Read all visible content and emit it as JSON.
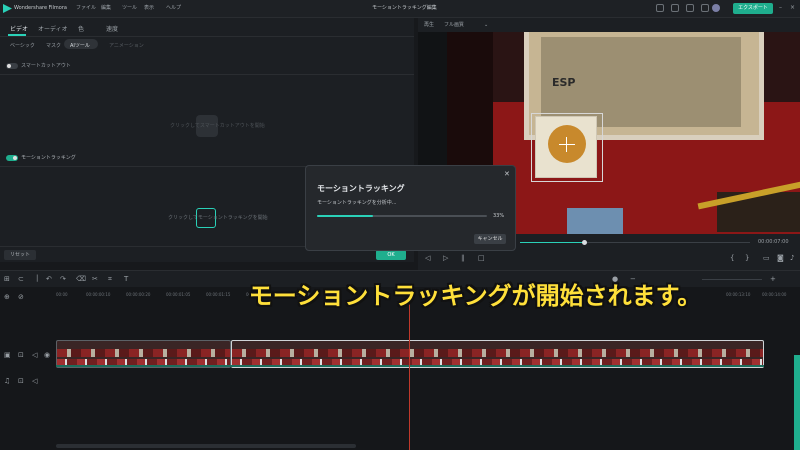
{
  "app": {
    "name": "Wondershare Filmora",
    "window_title": "モーショントラッキング編集",
    "menu": [
      "ファイル",
      "編集",
      "ツール",
      "表示",
      "ヘルプ"
    ],
    "export_label": "エクスポート"
  },
  "left_panel": {
    "tabs": [
      "ビデオ",
      "オーディオ",
      "色",
      "速度"
    ],
    "subtabs": [
      "ベーシック",
      "マスク",
      "AIツール",
      "アニメーション"
    ],
    "smart_cutout_label": "スマートカットアウト",
    "smart_cutout_hint": "クリックしてスマートカットアウトを開始",
    "motion_tracking_label": "モーショントラッキング",
    "motion_tracking_hint": "クリックしてモーショントラッキングを開始",
    "reset_label": "リセット",
    "ok_label": "OK"
  },
  "preview": {
    "quality_label": "再生",
    "quality_value": "フル画質",
    "timecode": "00:00:07:00",
    "sign_text": "ESP"
  },
  "timeline": {
    "ticks": [
      "00:00",
      "00:00:00:10",
      "00:00:00:20",
      "00:00:01:05",
      "00:00:01:15",
      "00:00:02:00",
      "00:00:02:10",
      "00:00:13:10",
      "00:00:14:00"
    ]
  },
  "modal": {
    "title": "モーショントラッキング",
    "status": "モーショントラッキングを分析中...",
    "progress_pct": 33,
    "progress_label": "33%",
    "cancel_label": "キャンセル"
  },
  "caption": "モーショントラッキングが開始されます。",
  "colors": {
    "accent": "#2ad1b8",
    "ok_green": "#1fae8e",
    "caption_yellow": "#ffe03a",
    "playhead": "#c0392b"
  }
}
